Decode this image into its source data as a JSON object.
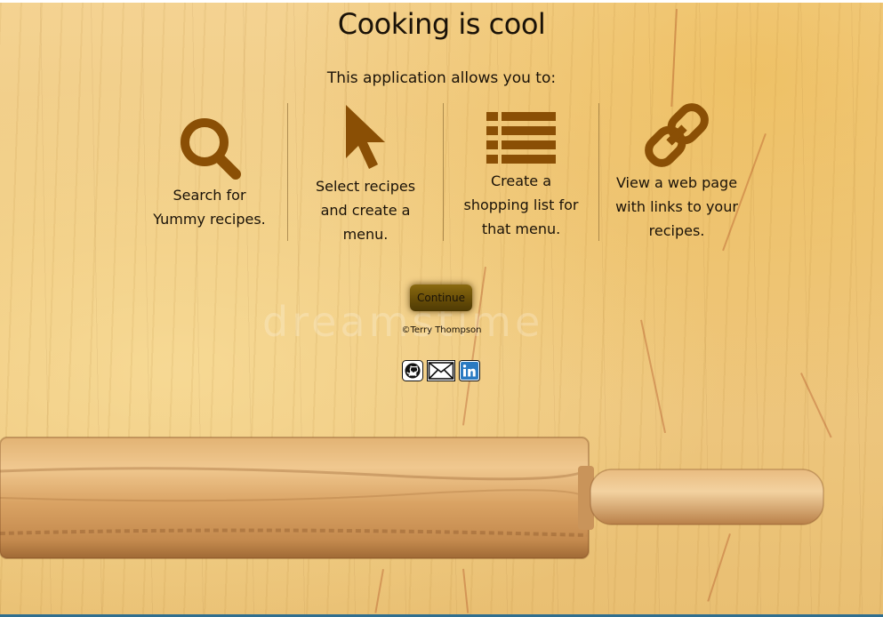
{
  "page": {
    "title": "Cooking is cool",
    "subtitle": "This application allows you to:"
  },
  "features": [
    {
      "icon": "search-icon",
      "text": "Search for Yummy recipes."
    },
    {
      "icon": "cursor-icon",
      "text": "Select recipes and create a menu."
    },
    {
      "icon": "list-icon",
      "text": "Create a shopping list for that menu."
    },
    {
      "icon": "link-icon",
      "text": "View a web page with links to your recipes."
    }
  ],
  "continue_label": "Continue",
  "copyright": "©Terry Thompson",
  "social": [
    {
      "icon": "github-icon",
      "label": "GitHub"
    },
    {
      "icon": "mail-icon",
      "label": "Email"
    },
    {
      "icon": "linkedin-icon",
      "label": "LinkedIn"
    }
  ],
  "watermark": "dreamstime",
  "colors": {
    "icon_brown": "#8a4f05",
    "button_gold": "#6b5008",
    "text_dark": "#1a1208",
    "linkedin_blue": "#2a7ac2"
  }
}
